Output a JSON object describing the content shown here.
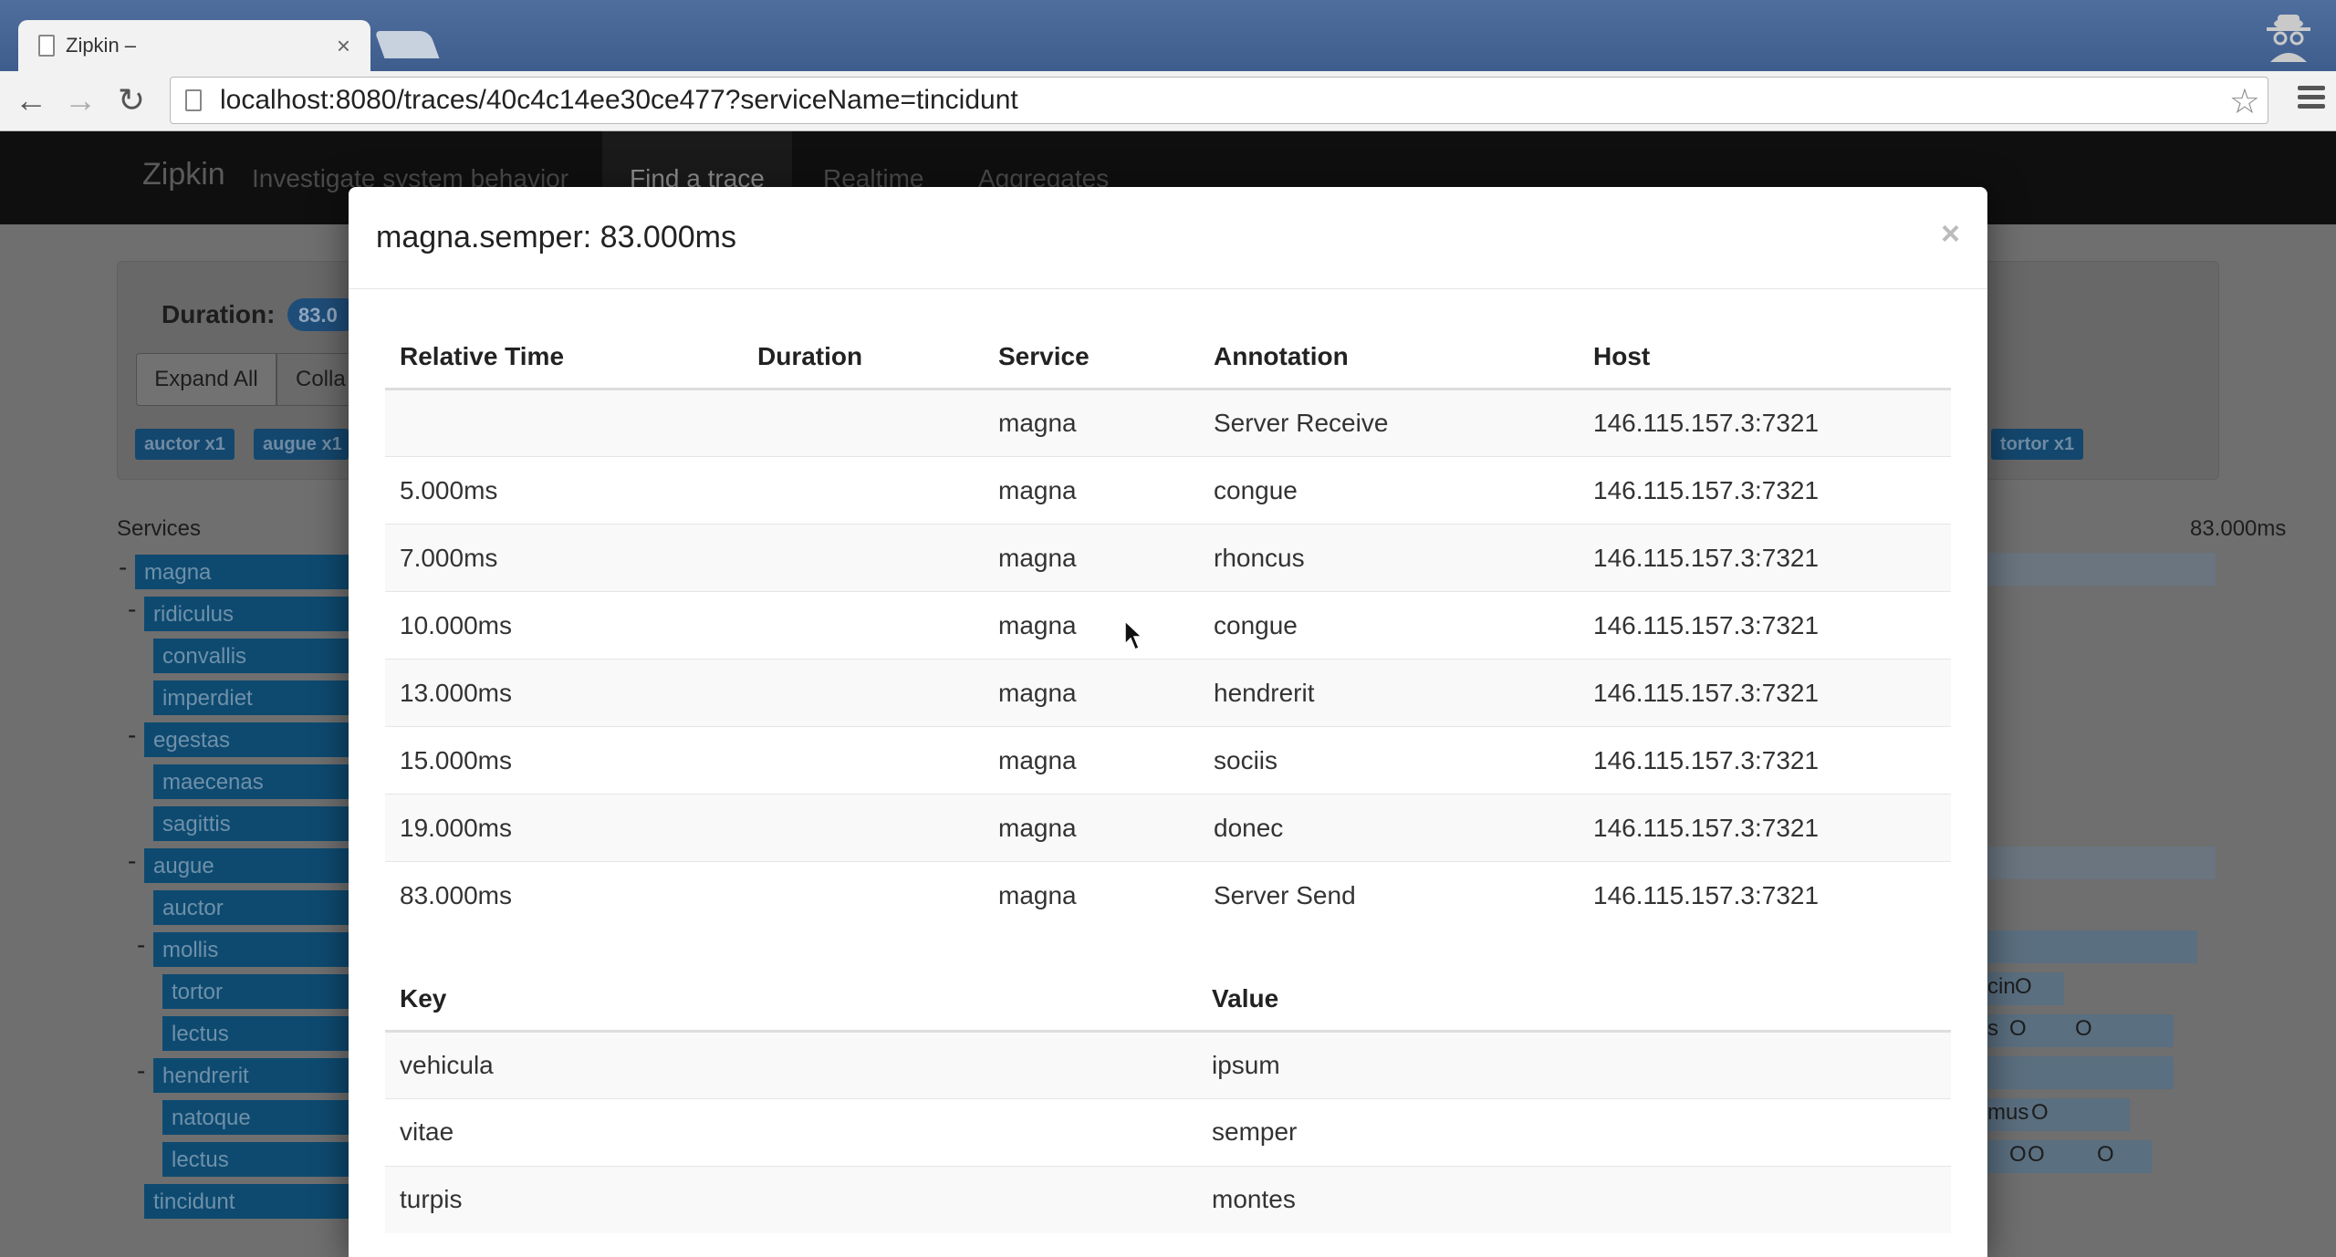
{
  "browser": {
    "tab_title": "Zipkin –",
    "tab_close": "×",
    "url": "localhost:8080/traces/40c4c14ee30ce477?serviceName=tincidunt",
    "back": "←",
    "forward": "→",
    "reload": "↻",
    "star": "☆"
  },
  "navbar": {
    "brand": "Zipkin",
    "tagline": "Investigate system behavior",
    "items": [
      "Find a trace",
      "Realtime",
      "Aggregates"
    ]
  },
  "summary": {
    "duration_label": "Duration:",
    "duration_value": "83.0",
    "expand_all": "Expand All",
    "collapse_all": "Colla",
    "badges": [
      "auctor x1",
      "augue x1",
      "tortor x1"
    ]
  },
  "trace": {
    "services_header": "Services",
    "total_duration": "83.000ms",
    "tree": [
      {
        "label": "magna",
        "minus": "-"
      },
      {
        "label": "ridiculus",
        "minus": "-"
      },
      {
        "label": "convallis",
        "minus": ""
      },
      {
        "label": "imperdiet",
        "minus": ""
      },
      {
        "label": "egestas",
        "minus": "-"
      },
      {
        "label": "maecenas",
        "minus": ""
      },
      {
        "label": "sagittis",
        "minus": ""
      },
      {
        "label": "augue",
        "minus": "-"
      },
      {
        "label": "auctor",
        "minus": ""
      },
      {
        "label": "mollis",
        "minus": "-"
      },
      {
        "label": "tortor",
        "minus": ""
      },
      {
        "label": "lectus",
        "minus": ""
      },
      {
        "label": "hendrerit",
        "minus": "-"
      },
      {
        "label": "natoque",
        "minus": ""
      },
      {
        "label": "lectus",
        "minus": ""
      },
      {
        "label": "tincidunt",
        "minus": ""
      }
    ],
    "timeline_fragments": [
      "cin",
      "s",
      "mus"
    ]
  },
  "modal": {
    "title": "magna.semper: 83.000ms",
    "close": "×",
    "annotation_headers": [
      "Relative Time",
      "Duration",
      "Service",
      "Annotation",
      "Host"
    ],
    "annotations": [
      [
        "",
        "",
        "magna",
        "Server Receive",
        "146.115.157.3:7321"
      ],
      [
        "5.000ms",
        "",
        "magna",
        "congue",
        "146.115.157.3:7321"
      ],
      [
        "7.000ms",
        "",
        "magna",
        "rhoncus",
        "146.115.157.3:7321"
      ],
      [
        "10.000ms",
        "",
        "magna",
        "congue",
        "146.115.157.3:7321"
      ],
      [
        "13.000ms",
        "",
        "magna",
        "hendrerit",
        "146.115.157.3:7321"
      ],
      [
        "15.000ms",
        "",
        "magna",
        "sociis",
        "146.115.157.3:7321"
      ],
      [
        "19.000ms",
        "",
        "magna",
        "donec",
        "146.115.157.3:7321"
      ],
      [
        "83.000ms",
        "",
        "magna",
        "Server Send",
        "146.115.157.3:7321"
      ]
    ],
    "kv_headers": [
      "Key",
      "Value"
    ],
    "kv": [
      [
        "vehicula",
        "ipsum"
      ],
      [
        "vitae",
        "semper"
      ],
      [
        "turpis",
        "montes"
      ]
    ]
  }
}
